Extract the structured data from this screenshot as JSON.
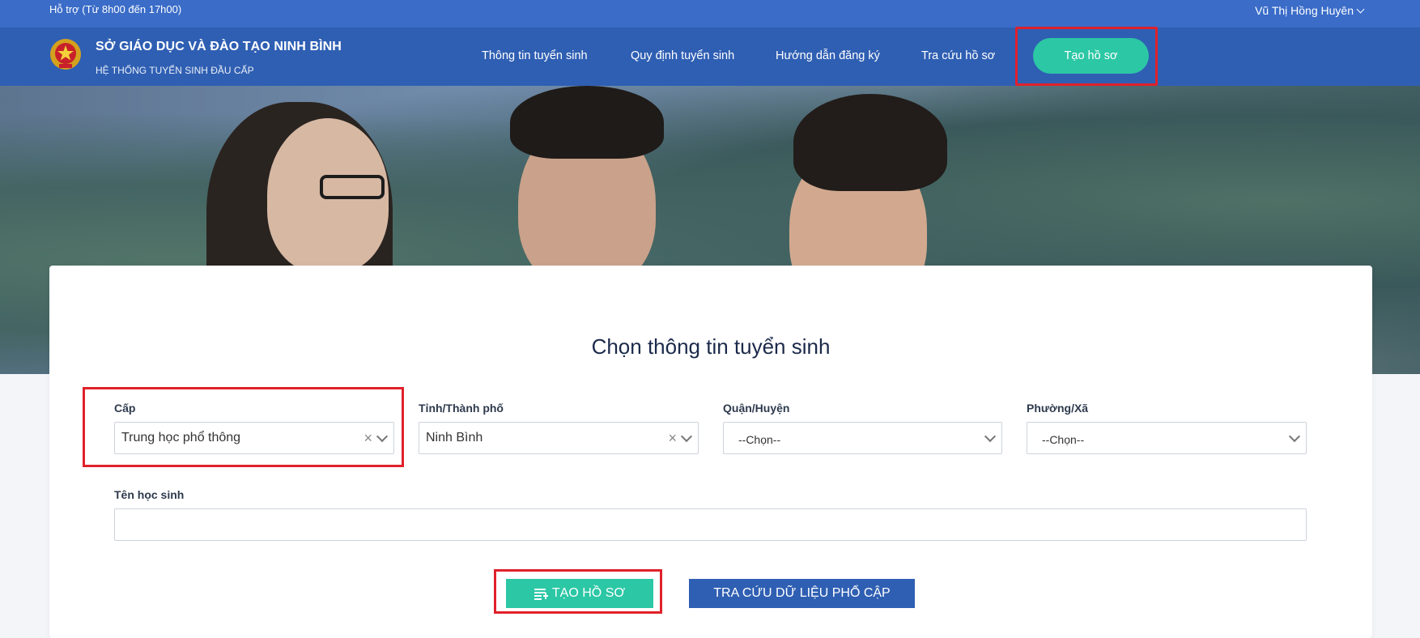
{
  "topbar": {
    "support_text": "Hỗ trợ (Từ 8h00 đến 17h00)",
    "user_name": "Vũ Thị Hồng Huyên"
  },
  "header": {
    "title": "SỞ GIÁO DỤC VÀ ĐÀO TẠO NINH BÌNH",
    "subtitle": "HỆ THỐNG TUYỂN SINH ĐẦU CẤP",
    "nav": [
      "Thông tin tuyển sinh",
      "Quy định tuyển sinh",
      "Hướng dẫn đăng ký",
      "Tra cứu hồ sơ"
    ],
    "cta_label": "Tạo hồ sơ"
  },
  "form": {
    "title": "Chọn thông tin tuyển sinh",
    "cap": {
      "label": "Cấp",
      "value": "Trung học phổ thông"
    },
    "province": {
      "label": "Tỉnh/Thành phố",
      "value": "Ninh Bình"
    },
    "district": {
      "label": "Quận/Huyện",
      "value": "--Chọn--"
    },
    "ward": {
      "label": "Phường/Xã",
      "value": "--Chọn--"
    },
    "student_name": {
      "label": "Tên học sinh",
      "value": ""
    },
    "create_button": "TẠO HỒ SƠ",
    "search_button": "TRA CỨU DỮ LIỆU PHỔ CẬP"
  },
  "colors": {
    "topbar": "#3a6cc8",
    "header": "#2f5fb3",
    "accent": "#2cc7a5",
    "highlight": "#e0212b"
  },
  "icons": {
    "logo": "national-emblem-icon",
    "user_dropdown": "chevron-down-icon",
    "select_clear": "close-icon",
    "select_arrow": "chevron-down-icon",
    "create_button_icon": "list-add-icon"
  }
}
